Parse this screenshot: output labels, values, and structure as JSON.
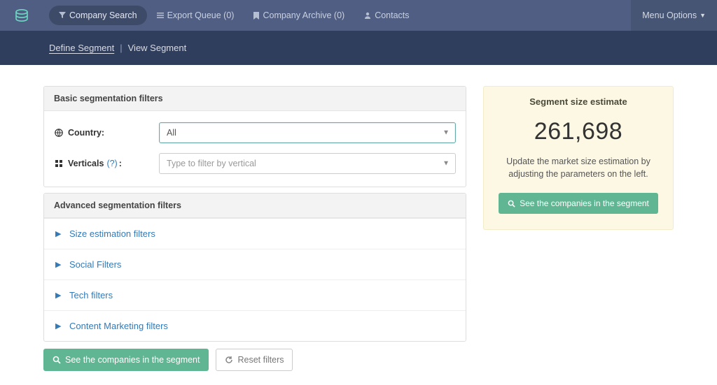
{
  "colors": {
    "accent": "#60b693",
    "link": "#337ab7",
    "topbar": "#4f5e82",
    "subbar": "#303e5d"
  },
  "nav": {
    "company_search": "Company Search",
    "export_queue": "Export Queue (0)",
    "company_archive": "Company Archive (0)",
    "contacts": "Contacts",
    "menu_options": "Menu Options"
  },
  "subnav": {
    "define": "Define Segment",
    "sep": "|",
    "view": "View Segment"
  },
  "basic": {
    "heading": "Basic segmentation filters",
    "country_label": "Country:",
    "country_value": "All",
    "verticals_label": "Verticals",
    "verticals_hint": "(?)",
    "verticals_colon": ":",
    "verticals_placeholder": "Type to filter by vertical"
  },
  "advanced": {
    "heading": "Advanced segmentation filters",
    "items": [
      "Size estimation filters",
      "Social Filters",
      "Tech filters",
      "Content Marketing filters"
    ]
  },
  "buttons": {
    "see_companies": "See the companies in the segment",
    "reset": "Reset filters"
  },
  "estimate": {
    "heading": "Segment size estimate",
    "value": "261,698",
    "desc": "Update the market size estimation by adjusting the parameters on the left.",
    "btn": "See the companies in the segment"
  }
}
